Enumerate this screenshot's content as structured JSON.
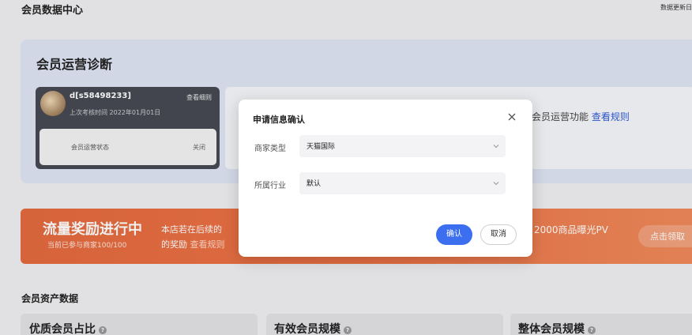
{
  "page": {
    "title": "会员数据中心",
    "update_text": "数据更新日"
  },
  "diagnosis": {
    "title": "会员运营诊断",
    "member": {
      "name": "d[s58498233]",
      "view_detail": "查看细则",
      "last_check": "上次考核时间 2022年01月01日",
      "status_label": "会员运营状态",
      "status_value": "关闭"
    },
    "info_text": "会员运营功能",
    "info_link": "查看规则"
  },
  "reward": {
    "title": "流量奖励进行中",
    "subtitle": "当前已参与商家100/100",
    "line1": "本店若在后续的",
    "line2": "的奖励",
    "line2_link": "查看规则",
    "pv_text": "2000商品曝光PV",
    "claim_label": "点击领取"
  },
  "assets": {
    "title": "会员资产数据",
    "cards": [
      {
        "label": "优质会员占比"
      },
      {
        "label": "有效会员规模"
      },
      {
        "label": "整体会员规模"
      }
    ]
  },
  "modal": {
    "title": "申请信息确认",
    "fields": [
      {
        "label": "商家类型",
        "value": "天猫国际"
      },
      {
        "label": "所属行业",
        "value": "默认"
      }
    ],
    "confirm_label": "确认",
    "cancel_label": "取消"
  },
  "colors": {
    "primary": "#3b6ff0",
    "link": "#2e5bd6",
    "banner": "#ee7447",
    "diag_bg": "#dfe5f4"
  }
}
